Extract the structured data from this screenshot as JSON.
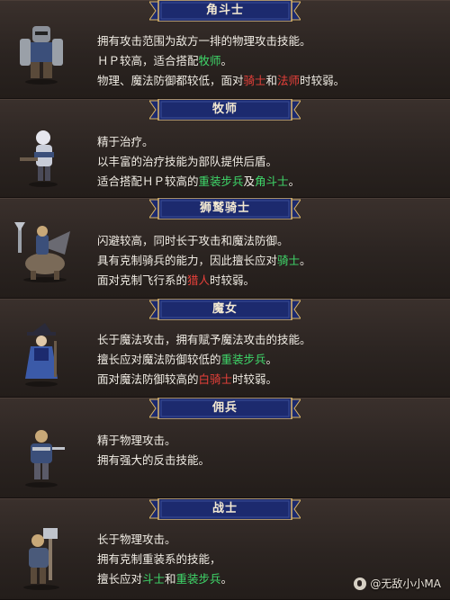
{
  "colors": {
    "banner_navy": "#1c2a6e",
    "banner_gold": "#d9b56a",
    "text_white": "#f0ece4",
    "highlight_red": "#e8403a",
    "highlight_green": "#3fd86a"
  },
  "sections": [
    {
      "title": "角斗士",
      "icon": "gladiator-sprite",
      "lines": [
        [
          {
            "t": "拥有攻击范围为敌方一排的物理攻击技能。"
          }
        ],
        [
          {
            "t": "ＨＰ较高，适合搭配"
          },
          {
            "t": "牧师",
            "c": "green"
          },
          {
            "t": "。"
          }
        ],
        [
          {
            "t": "物理、魔法防御都较低，面对"
          },
          {
            "t": "骑士",
            "c": "red"
          },
          {
            "t": "和"
          },
          {
            "t": "法师",
            "c": "red"
          },
          {
            "t": "时较弱。"
          }
        ]
      ]
    },
    {
      "title": "牧师",
      "icon": "cleric-sprite",
      "lines": [
        [
          {
            "t": "精于治疗。"
          }
        ],
        [
          {
            "t": "以丰富的治疗技能为部队提供后盾。"
          }
        ],
        [
          {
            "t": "适合搭配ＨＰ较高的"
          },
          {
            "t": "重装步兵",
            "c": "green"
          },
          {
            "t": "及"
          },
          {
            "t": "角斗士",
            "c": "green"
          },
          {
            "t": "。"
          }
        ]
      ]
    },
    {
      "title": "狮鹫骑士",
      "icon": "griffin-knight-sprite",
      "lines": [
        [
          {
            "t": "闪避较高，同时长于攻击和魔法防御。"
          }
        ],
        [
          {
            "t": "具有克制骑兵的能力，因此擅长应对"
          },
          {
            "t": "骑士",
            "c": "green"
          },
          {
            "t": "。"
          }
        ],
        [
          {
            "t": "面对克制飞行系的"
          },
          {
            "t": "猎人",
            "c": "red"
          },
          {
            "t": "时较弱。"
          }
        ]
      ]
    },
    {
      "title": "魔女",
      "icon": "witch-sprite",
      "lines": [
        [
          {
            "t": "长于魔法攻击，拥有赋予魔法攻击的技能。"
          }
        ],
        [
          {
            "t": "擅长应对魔法防御较低的"
          },
          {
            "t": "重装步兵",
            "c": "green"
          },
          {
            "t": "。"
          }
        ],
        [
          {
            "t": "面对魔法防御较高的"
          },
          {
            "t": "白骑士",
            "c": "red"
          },
          {
            "t": "时较弱。"
          }
        ]
      ]
    },
    {
      "title": "佣兵",
      "icon": "mercenary-sprite",
      "lines": [
        [
          {
            "t": "精于物理攻击。"
          }
        ],
        [
          {
            "t": "拥有强大的反击技能。"
          }
        ]
      ]
    },
    {
      "title": "战士",
      "icon": "warrior-sprite",
      "lines": [
        [
          {
            "t": "长于物理攻击。"
          }
        ],
        [
          {
            "t": "拥有克制重装系的技能，"
          }
        ],
        [
          {
            "t": "擅长应对"
          },
          {
            "t": "斗士",
            "c": "green"
          },
          {
            "t": "和"
          },
          {
            "t": "重装步兵",
            "c": "green"
          },
          {
            "t": "。"
          }
        ]
      ]
    }
  ],
  "watermark": "@无敌小小MA"
}
